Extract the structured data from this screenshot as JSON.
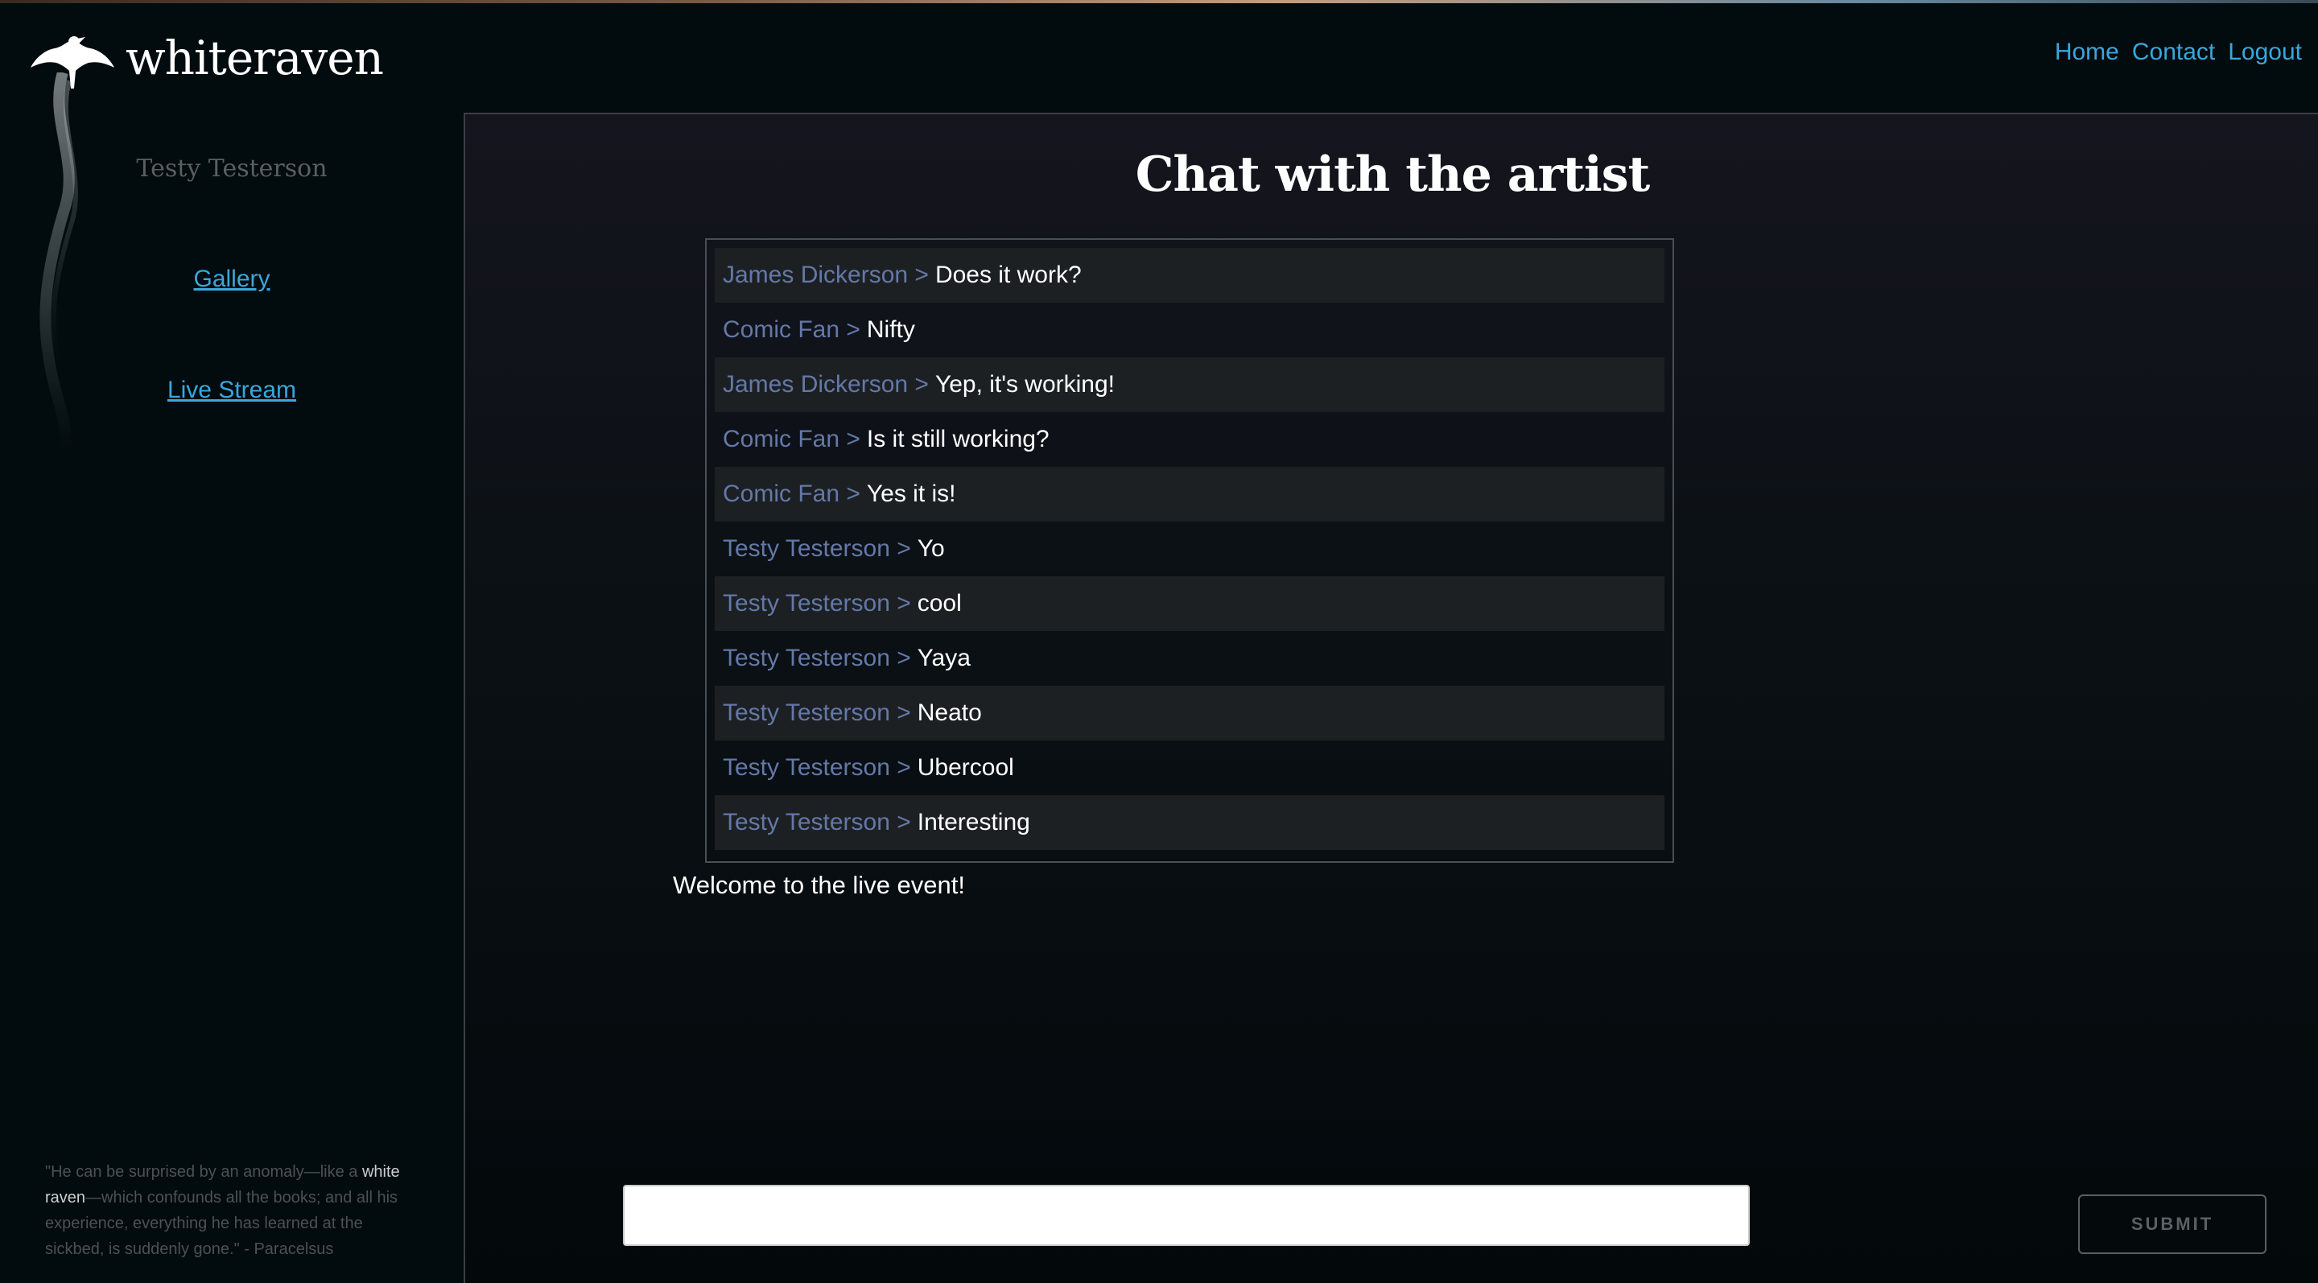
{
  "header": {
    "brand": "whiteraven",
    "nav": [
      "Home",
      "Contact",
      "Logout"
    ]
  },
  "sidebar": {
    "user_name": "Testy Testerson",
    "links": [
      "Gallery",
      "Live Stream"
    ],
    "quote": {
      "before": "\"He can be surprised by an anomaly—like a ",
      "highlight1": "white",
      "highlight2": "raven",
      "after": "—which confounds all the books; and all his experience, everything he has learned at the sickbed, is suddenly gone.\" - Paracelsus"
    }
  },
  "main": {
    "title": "Chat with the artist",
    "messages": [
      {
        "sender": "James Dickerson >",
        "text": "Does it work?"
      },
      {
        "sender": "Comic Fan >",
        "text": "Nifty"
      },
      {
        "sender": "James Dickerson >",
        "text": "Yep, it's working!"
      },
      {
        "sender": "Comic Fan >",
        "text": "Is it still working?"
      },
      {
        "sender": "Comic Fan >",
        "text": "Yes it is!"
      },
      {
        "sender": "Testy Testerson >",
        "text": "Yo"
      },
      {
        "sender": "Testy Testerson >",
        "text": "cool"
      },
      {
        "sender": "Testy Testerson >",
        "text": "Yaya"
      },
      {
        "sender": "Testy Testerson >",
        "text": "Neato"
      },
      {
        "sender": "Testy Testerson >",
        "text": "Ubercool"
      },
      {
        "sender": "Testy Testerson >",
        "text": "Interesting"
      }
    ],
    "welcome": "Welcome to the live event!",
    "input_value": "",
    "submit_label": "SUBMIT"
  },
  "colors": {
    "background": "#020b0d",
    "link": "#3aa6dd",
    "sender": "#6478a8",
    "row_alt": "#1d2023"
  }
}
